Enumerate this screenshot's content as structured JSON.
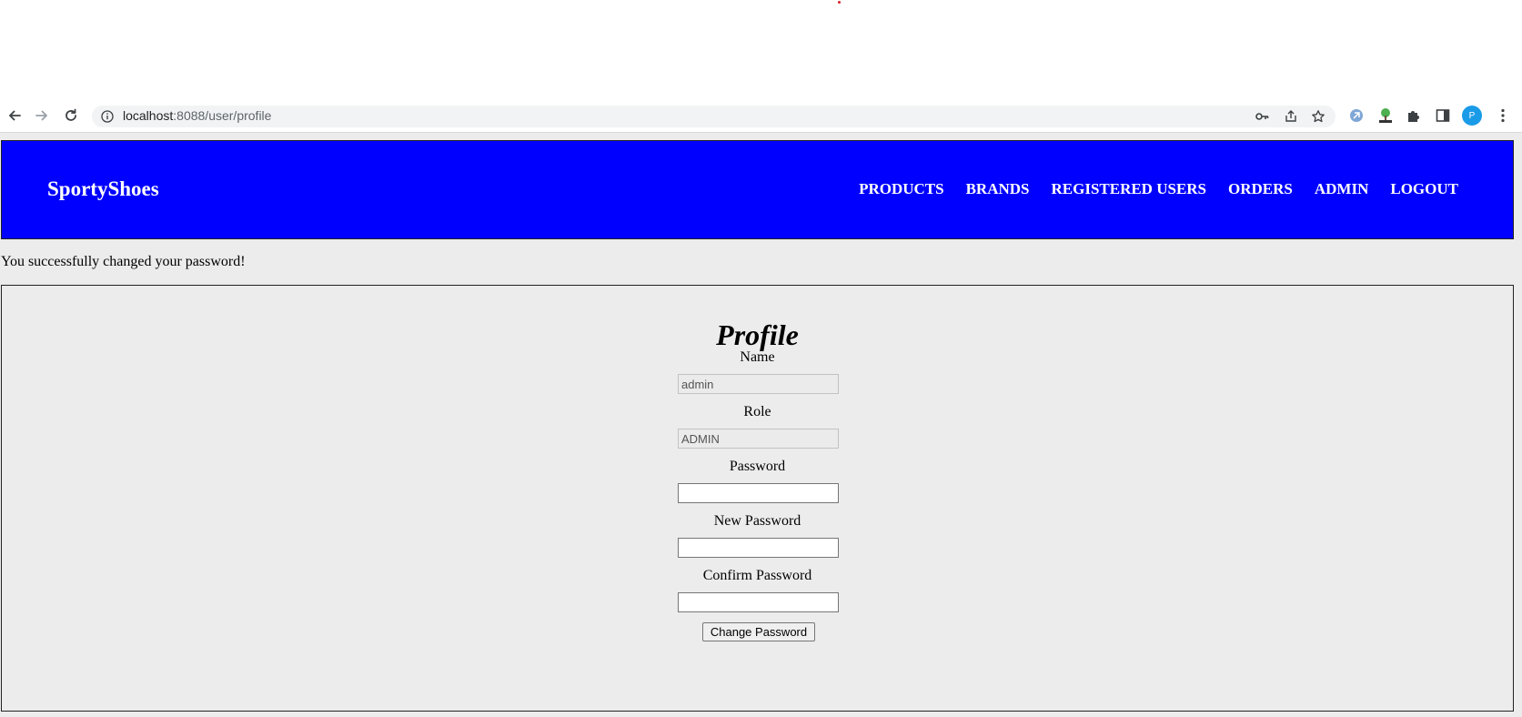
{
  "browser": {
    "url_host": "localhost",
    "url_rest": ":8088/user/profile",
    "avatar_letter": "P",
    "icons": [
      "back-arrow-icon",
      "forward-arrow-icon",
      "reload-icon",
      "info-icon",
      "key-icon",
      "share-icon",
      "star-icon",
      "extension-icon",
      "tree-icon",
      "puzzle-icon",
      "side-panel-icon",
      "menu-dots-icon"
    ]
  },
  "navbar": {
    "brand": "SportyShoes",
    "links": [
      "PRODUCTS",
      "BRANDS",
      "REGISTERED USERS",
      "ORDERS",
      "ADMIN",
      "LOGOUT"
    ],
    "color": "#0000ff"
  },
  "flash_message": "You successfully changed your password!",
  "profile": {
    "title": "Profile",
    "name_label": "Name",
    "name_value": "admin",
    "role_label": "Role",
    "role_value": "ADMIN",
    "password_label": "Password",
    "new_password_label": "New Password",
    "confirm_password_label": "Confirm Password",
    "submit_label": "Change Password"
  }
}
